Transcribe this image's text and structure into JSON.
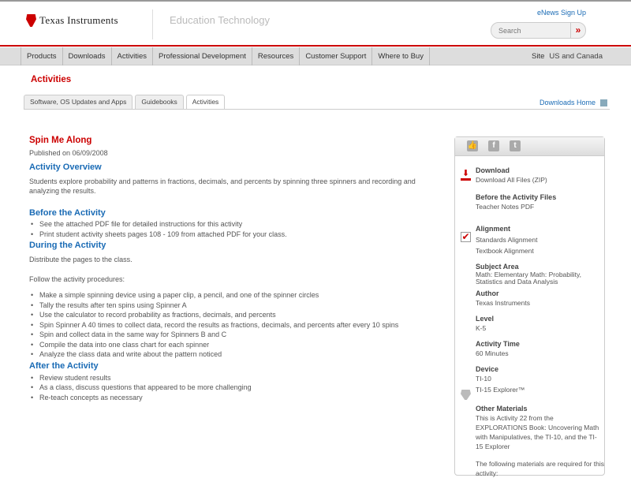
{
  "header": {
    "brand": "Texas Instruments",
    "section": "Education Technology",
    "enews": "eNews Sign Up",
    "search_placeholder": "Search",
    "search_go": "»"
  },
  "nav": {
    "items": [
      "Products",
      "Downloads",
      "Activities",
      "Professional Development",
      "Resources",
      "Customer Support",
      "Where to Buy"
    ],
    "site_label": "Site",
    "site_value": "US and Canada"
  },
  "page_heading": "Activities",
  "tabs": [
    "Software, OS Updates and Apps",
    "Guidebooks",
    "Activities"
  ],
  "downloads_home": "Downloads Home",
  "main": {
    "title": "Spin Me Along",
    "published": "Published on 06/09/2008",
    "overview_h": "Activity Overview",
    "overview": "Students explore probability and patterns in fractions, decimals, and percents by spinning three spinners and recording and analyzing the results.",
    "before_h": "Before the Activity",
    "before": [
      "See the attached PDF file for detailed instructions for this activity",
      "Print student activity sheets pages 108 - 109 from attached PDF for your class."
    ],
    "during_h": "During the Activity",
    "during_p1": "Distribute the pages to the class.",
    "during_p2": "Follow the activity procedures:",
    "during": [
      "Make a simple spinning device using a paper clip, a pencil, and one of the spinner circles",
      "Tally the results after ten spins using Spinner A",
      "Use the calculator to record probability as fractions, decimals, and percents",
      "Spin Spinner A 40 times to collect data, record the results as fractions, decimals, and percents after every 10 spins",
      "Spin and collect data in the same way for Spinners B and C",
      "Compile the data into one class chart for each spinner",
      "Analyze the class data and write about the pattern noticed"
    ],
    "after_h": "After the Activity",
    "after": [
      "Review student results",
      "As a class, discuss questions that appeared to be more challenging",
      "Re-teach concepts as necessary"
    ]
  },
  "sidebar": {
    "social": [
      "like",
      "f",
      "t"
    ],
    "download_h": "Download",
    "download_all": "Download All Files (ZIP)",
    "before_files_h": "Before the Activity Files",
    "teacher_notes": "Teacher Notes PDF",
    "alignment_h": "Alignment",
    "standards": "Standards Alignment",
    "textbook": "Textbook Alignment",
    "subject_h": "Subject Area",
    "subject": "Math: Elementary Math: Probability, Statistics and Data Analysis",
    "author_h": "Author",
    "author": "Texas Instruments",
    "level_h": "Level",
    "level": "K-5",
    "time_h": "Activity Time",
    "time": "60 Minutes",
    "device_h": "Device",
    "devices": [
      "TI-10",
      "TI-15 Explorer™"
    ],
    "materials_h": "Other Materials",
    "materials": "This is Activity 22 from the EXPLORATIONS Book: Uncovering Math with Manipulatives, the TI-10, and the TI-15 Explorer",
    "materials2": "The following materials are required for this activity:"
  }
}
